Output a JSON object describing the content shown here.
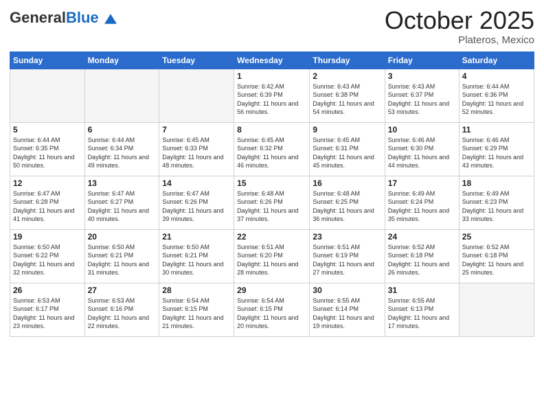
{
  "header": {
    "logo_general": "General",
    "logo_blue": "Blue",
    "month": "October 2025",
    "location": "Plateros, Mexico"
  },
  "days_of_week": [
    "Sunday",
    "Monday",
    "Tuesday",
    "Wednesday",
    "Thursday",
    "Friday",
    "Saturday"
  ],
  "weeks": [
    [
      {
        "day": "",
        "info": ""
      },
      {
        "day": "",
        "info": ""
      },
      {
        "day": "",
        "info": ""
      },
      {
        "day": "1",
        "info": "Sunrise: 6:42 AM\nSunset: 6:39 PM\nDaylight: 11 hours\nand 56 minutes."
      },
      {
        "day": "2",
        "info": "Sunrise: 6:43 AM\nSunset: 6:38 PM\nDaylight: 11 hours\nand 54 minutes."
      },
      {
        "day": "3",
        "info": "Sunrise: 6:43 AM\nSunset: 6:37 PM\nDaylight: 11 hours\nand 53 minutes."
      },
      {
        "day": "4",
        "info": "Sunrise: 6:44 AM\nSunset: 6:36 PM\nDaylight: 11 hours\nand 52 minutes."
      }
    ],
    [
      {
        "day": "5",
        "info": "Sunrise: 6:44 AM\nSunset: 6:35 PM\nDaylight: 11 hours\nand 50 minutes."
      },
      {
        "day": "6",
        "info": "Sunrise: 6:44 AM\nSunset: 6:34 PM\nDaylight: 11 hours\nand 49 minutes."
      },
      {
        "day": "7",
        "info": "Sunrise: 6:45 AM\nSunset: 6:33 PM\nDaylight: 11 hours\nand 48 minutes."
      },
      {
        "day": "8",
        "info": "Sunrise: 6:45 AM\nSunset: 6:32 PM\nDaylight: 11 hours\nand 46 minutes."
      },
      {
        "day": "9",
        "info": "Sunrise: 6:45 AM\nSunset: 6:31 PM\nDaylight: 11 hours\nand 45 minutes."
      },
      {
        "day": "10",
        "info": "Sunrise: 6:46 AM\nSunset: 6:30 PM\nDaylight: 11 hours\nand 44 minutes."
      },
      {
        "day": "11",
        "info": "Sunrise: 6:46 AM\nSunset: 6:29 PM\nDaylight: 11 hours\nand 43 minutes."
      }
    ],
    [
      {
        "day": "12",
        "info": "Sunrise: 6:47 AM\nSunset: 6:28 PM\nDaylight: 11 hours\nand 41 minutes."
      },
      {
        "day": "13",
        "info": "Sunrise: 6:47 AM\nSunset: 6:27 PM\nDaylight: 11 hours\nand 40 minutes."
      },
      {
        "day": "14",
        "info": "Sunrise: 6:47 AM\nSunset: 6:26 PM\nDaylight: 11 hours\nand 39 minutes."
      },
      {
        "day": "15",
        "info": "Sunrise: 6:48 AM\nSunset: 6:26 PM\nDaylight: 11 hours\nand 37 minutes."
      },
      {
        "day": "16",
        "info": "Sunrise: 6:48 AM\nSunset: 6:25 PM\nDaylight: 11 hours\nand 36 minutes."
      },
      {
        "day": "17",
        "info": "Sunrise: 6:49 AM\nSunset: 6:24 PM\nDaylight: 11 hours\nand 35 minutes."
      },
      {
        "day": "18",
        "info": "Sunrise: 6:49 AM\nSunset: 6:23 PM\nDaylight: 11 hours\nand 33 minutes."
      }
    ],
    [
      {
        "day": "19",
        "info": "Sunrise: 6:50 AM\nSunset: 6:22 PM\nDaylight: 11 hours\nand 32 minutes."
      },
      {
        "day": "20",
        "info": "Sunrise: 6:50 AM\nSunset: 6:21 PM\nDaylight: 11 hours\nand 31 minutes."
      },
      {
        "day": "21",
        "info": "Sunrise: 6:50 AM\nSunset: 6:21 PM\nDaylight: 11 hours\nand 30 minutes."
      },
      {
        "day": "22",
        "info": "Sunrise: 6:51 AM\nSunset: 6:20 PM\nDaylight: 11 hours\nand 28 minutes."
      },
      {
        "day": "23",
        "info": "Sunrise: 6:51 AM\nSunset: 6:19 PM\nDaylight: 11 hours\nand 27 minutes."
      },
      {
        "day": "24",
        "info": "Sunrise: 6:52 AM\nSunset: 6:18 PM\nDaylight: 11 hours\nand 26 minutes."
      },
      {
        "day": "25",
        "info": "Sunrise: 6:52 AM\nSunset: 6:18 PM\nDaylight: 11 hours\nand 25 minutes."
      }
    ],
    [
      {
        "day": "26",
        "info": "Sunrise: 6:53 AM\nSunset: 6:17 PM\nDaylight: 11 hours\nand 23 minutes."
      },
      {
        "day": "27",
        "info": "Sunrise: 6:53 AM\nSunset: 6:16 PM\nDaylight: 11 hours\nand 22 minutes."
      },
      {
        "day": "28",
        "info": "Sunrise: 6:54 AM\nSunset: 6:15 PM\nDaylight: 11 hours\nand 21 minutes."
      },
      {
        "day": "29",
        "info": "Sunrise: 6:54 AM\nSunset: 6:15 PM\nDaylight: 11 hours\nand 20 minutes."
      },
      {
        "day": "30",
        "info": "Sunrise: 6:55 AM\nSunset: 6:14 PM\nDaylight: 11 hours\nand 19 minutes."
      },
      {
        "day": "31",
        "info": "Sunrise: 6:55 AM\nSunset: 6:13 PM\nDaylight: 11 hours\nand 17 minutes."
      },
      {
        "day": "",
        "info": ""
      }
    ]
  ]
}
